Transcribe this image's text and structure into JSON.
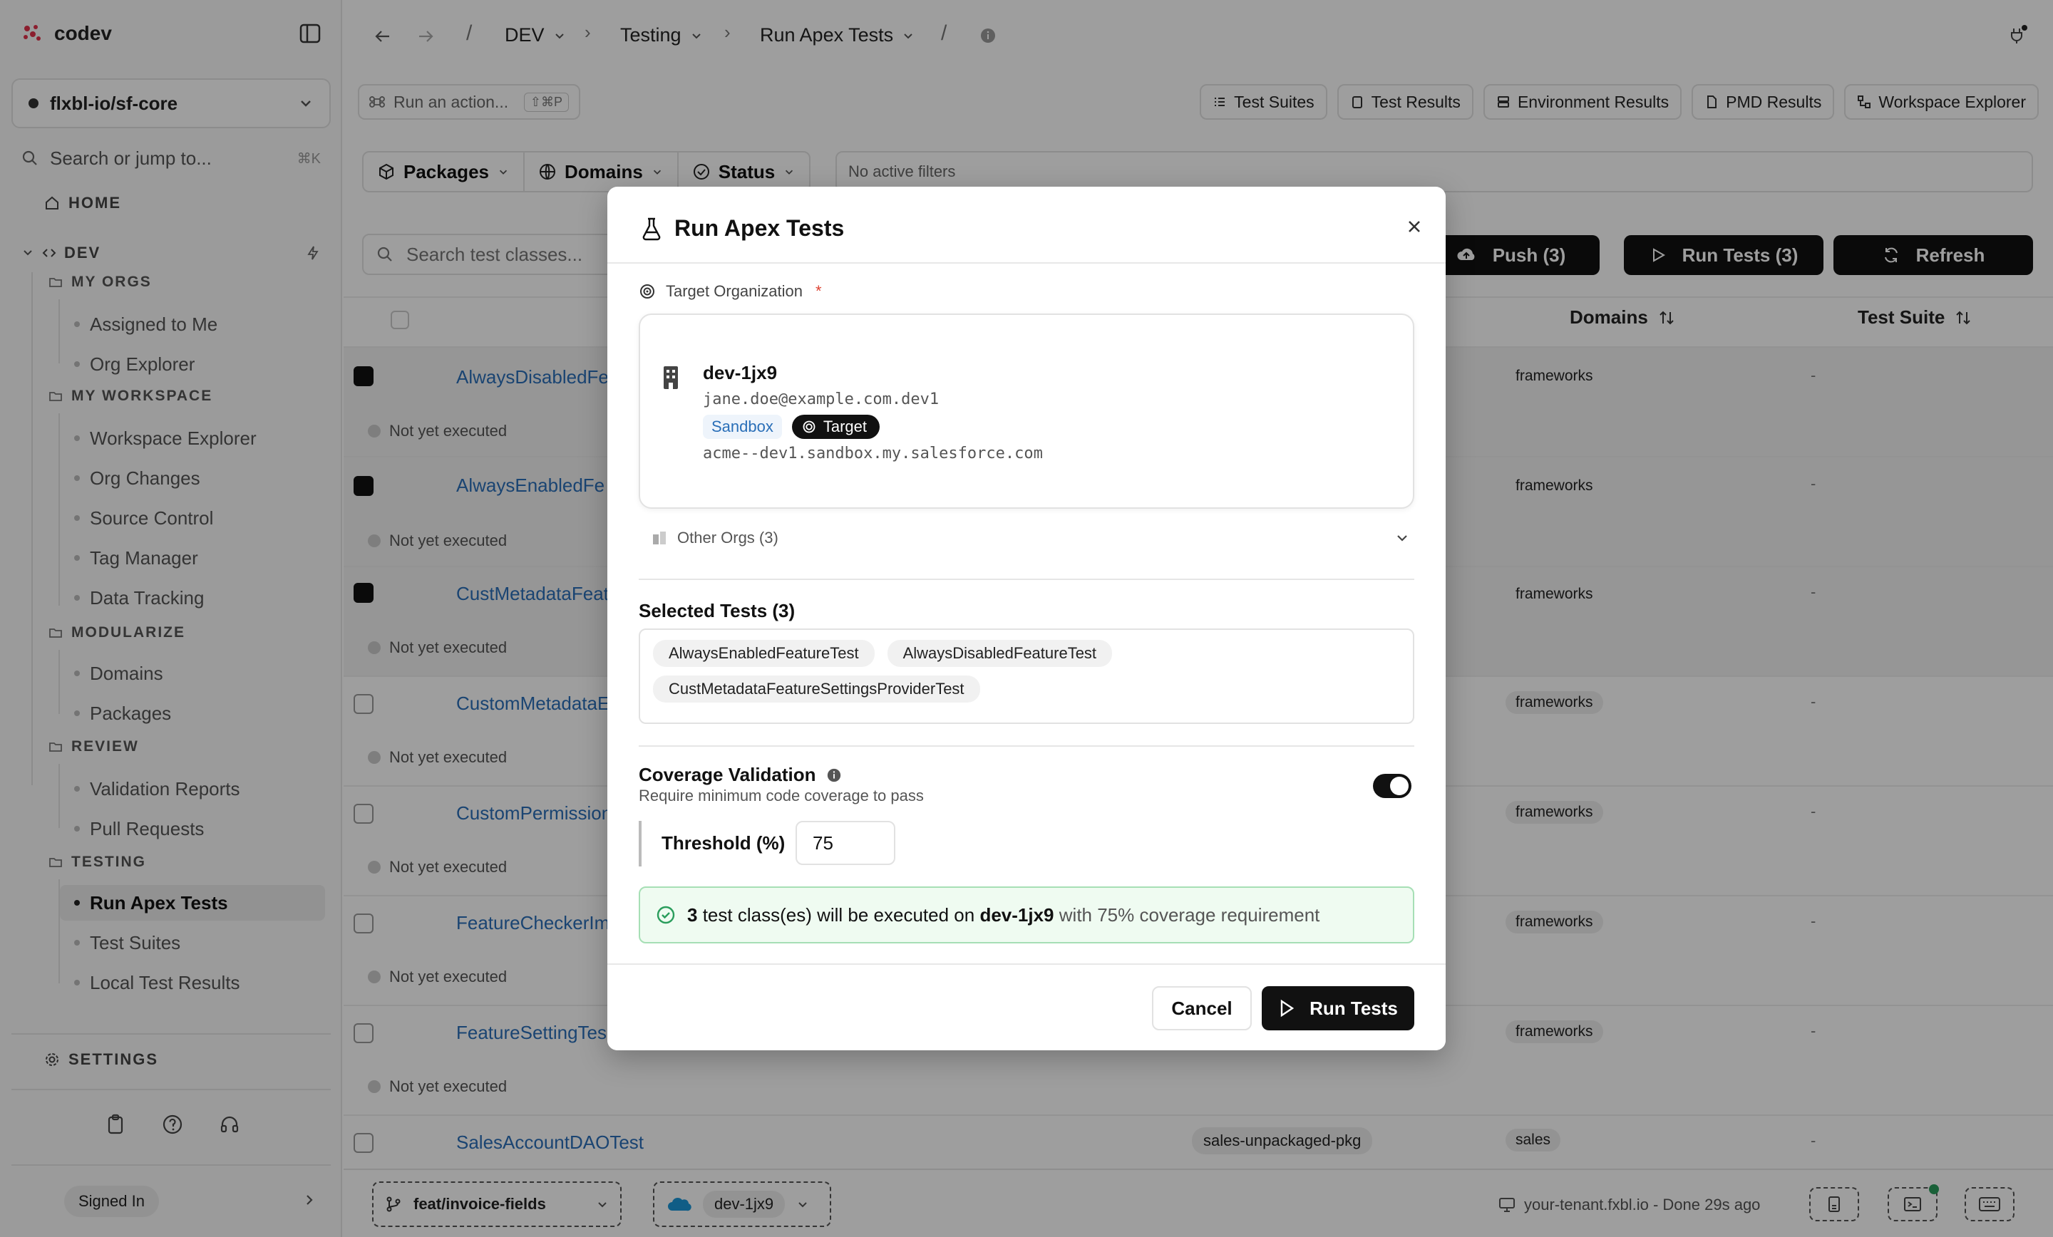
{
  "app": {
    "name": "codev"
  },
  "sidebar": {
    "workspace": "flxbl-io/sf-core",
    "search_placeholder": "Search or jump to...",
    "search_kbd": "⌘K",
    "home": "HOME",
    "dev": "DEV",
    "sections": {
      "my_orgs": {
        "title": "MY ORGS",
        "items": [
          "Assigned to Me",
          "Org Explorer"
        ]
      },
      "my_workspace": {
        "title": "MY WORKSPACE",
        "items": [
          "Workspace Explorer",
          "Org Changes",
          "Source Control",
          "Tag Manager",
          "Data Tracking"
        ]
      },
      "modularize": {
        "title": "MODULARIZE",
        "items": [
          "Domains",
          "Packages"
        ]
      },
      "review": {
        "title": "REVIEW",
        "items": [
          "Validation Reports",
          "Pull Requests"
        ]
      },
      "testing": {
        "title": "TESTING",
        "items": [
          "Run Apex Tests",
          "Test Suites",
          "Local Test Results"
        ]
      }
    },
    "settings": "SETTINGS",
    "signed_in": "Signed In"
  },
  "breadcrumb": [
    "DEV",
    "Testing",
    "Run Apex Tests"
  ],
  "action_bar": {
    "placeholder": "Run an action...",
    "kbd": "⇧⌘P"
  },
  "nav_buttons": [
    "Test Suites",
    "Test Results",
    "Environment Results",
    "PMD Results",
    "Workspace Explorer"
  ],
  "filters": {
    "packages": "Packages",
    "domains": "Domains",
    "status": "Status",
    "active": "No active filters"
  },
  "search_tests": "Search test classes...",
  "toolbar": {
    "push": "Push (3)",
    "run": "Run Tests (3)",
    "refresh": "Refresh"
  },
  "table": {
    "headers": {
      "domains": "Domains",
      "suite": "Test Suite"
    },
    "rows": [
      {
        "name": "AlwaysDisabledFe",
        "status": "Not yet executed",
        "domain": "frameworks",
        "suite": "-",
        "selected": true
      },
      {
        "name": "AlwaysEnabledFe",
        "status": "Not yet executed",
        "domain": "frameworks",
        "suite": "-",
        "selected": true
      },
      {
        "name": "CustMetadataFeat",
        "status": "Not yet executed",
        "domain": "frameworks",
        "suite": "-",
        "selected": true
      },
      {
        "name": "CustomMetadataE",
        "status": "Not yet executed",
        "domain": "frameworks",
        "suite": "-",
        "selected": false
      },
      {
        "name": "CustomPermission",
        "status": "Not yet executed",
        "domain": "frameworks",
        "suite": "-",
        "selected": false
      },
      {
        "name": "FeatureCheckerIm",
        "status": "Not yet executed",
        "domain": "frameworks",
        "suite": "-",
        "selected": false
      },
      {
        "name": "FeatureSettingTes",
        "status": "Not yet executed",
        "domain": "frameworks",
        "suite": "-",
        "selected": false
      },
      {
        "name": "SalesAccountDAOTest",
        "package": "sales-unpackaged-pkg",
        "domain": "sales",
        "suite": "-",
        "selected": false
      }
    ]
  },
  "bottom": {
    "branch": "feat/invoice-fields",
    "org": "dev-1jx9",
    "tenant": "your-tenant.fxbl.io - Done 29s ago"
  },
  "modal": {
    "title": "Run Apex Tests",
    "target_label": "Target Organization",
    "required": "*",
    "org": {
      "name": "dev-1jx9",
      "user": "jane.doe@example.com.dev1",
      "tag_sandbox": "Sandbox",
      "tag_target": "Target",
      "url": "acme--dev1.sandbox.my.salesforce.com"
    },
    "other_orgs": "Other Orgs (3)",
    "selected_title": "Selected Tests (3)",
    "selected_tests": [
      "AlwaysEnabledFeatureTest",
      "AlwaysDisabledFeatureTest",
      "CustMetadataFeatureSettingsProviderTest"
    ],
    "coverage_title": "Coverage Validation",
    "coverage_sub": "Require minimum code coverage to pass",
    "coverage_enabled": true,
    "threshold_label": "Threshold (%)",
    "threshold_value": "75",
    "summary": {
      "count": "3",
      "mid": "test class(es) will be executed on",
      "org": "dev-1jx9",
      "tail": "with 75% coverage requirement"
    },
    "cancel": "Cancel",
    "run": "Run Tests"
  }
}
